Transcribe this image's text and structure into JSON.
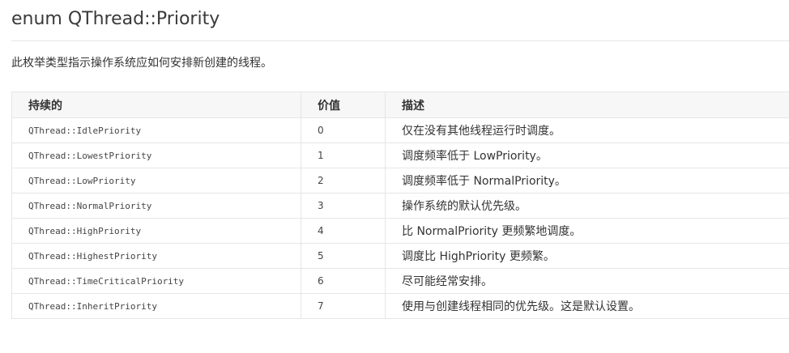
{
  "heading": "enum QThread::Priority",
  "description": "此枚举类型指示操作系统应如何安排新创建的线程。",
  "table": {
    "headers": [
      "持续的",
      "价值",
      "描述"
    ],
    "rows": [
      {
        "name": "QThread::IdlePriority",
        "value": "0",
        "desc": "仅在没有其他线程运行时调度。"
      },
      {
        "name": "QThread::LowestPriority",
        "value": "1",
        "desc": "调度频率低于 LowPriority。"
      },
      {
        "name": "QThread::LowPriority",
        "value": "2",
        "desc": "调度频率低于 NormalPriority。"
      },
      {
        "name": "QThread::NormalPriority",
        "value": "3",
        "desc": "操作系统的默认优先级。"
      },
      {
        "name": "QThread::HighPriority",
        "value": "4",
        "desc": "比 NormalPriority 更频繁地调度。"
      },
      {
        "name": "QThread::HighestPriority",
        "value": "5",
        "desc": "调度比 HighPriority 更频繁。"
      },
      {
        "name": "QThread::TimeCriticalPriority",
        "value": "6",
        "desc": "尽可能经常安排。"
      },
      {
        "name": "QThread::InheritPriority",
        "value": "7",
        "desc": "使用与创建线程相同的优先级。这是默认设置。"
      }
    ]
  }
}
